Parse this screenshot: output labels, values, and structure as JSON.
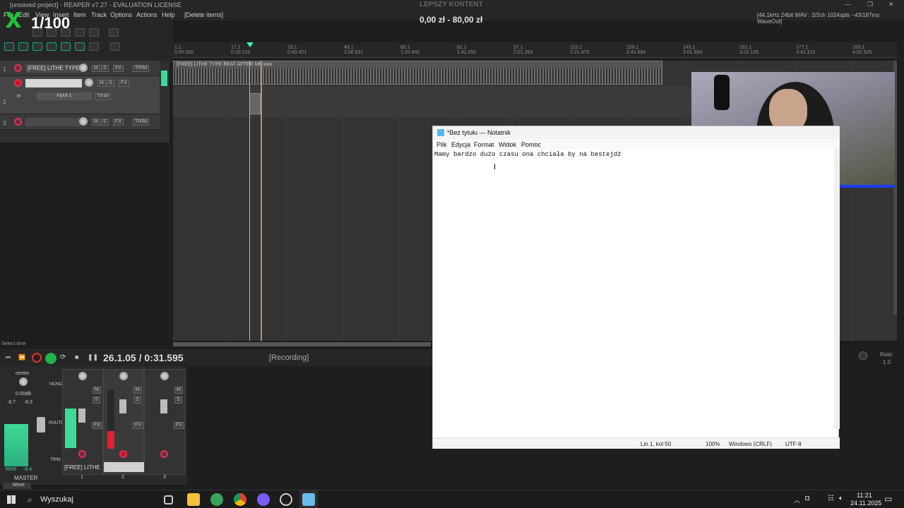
{
  "window": {
    "title": "[unsaved project] - REAPER v7.27 - EVALUATION LICENSE",
    "overlay_text": "LEPSZY KONTENT",
    "donation": "0,00 zł - 80,00 zł",
    "counter": "1/100",
    "audio_info": "[44.1kHz 24bit WAV : 2/2ch 1024spls ~43/187ms WaveOut]"
  },
  "menu": [
    "File",
    "Edit",
    "View",
    "Insert",
    "Item",
    "Track",
    "Options",
    "Actions",
    "Help",
    "[Delete items]"
  ],
  "ruler": [
    {
      "bar": "1.1",
      "time": "0:00.000"
    },
    {
      "bar": "17.1",
      "time": "0:20.210"
    },
    {
      "bar": "33.1",
      "time": "0:40.421"
    },
    {
      "bar": "49.1",
      "time": "1:00.631"
    },
    {
      "bar": "65.1",
      "time": "1:20.842"
    },
    {
      "bar": "81.1",
      "time": "1:41.052"
    },
    {
      "bar": "97.1",
      "time": "2:01.263"
    },
    {
      "bar": "113.1",
      "time": "2:21.473"
    },
    {
      "bar": "129.1",
      "time": "2:41.684"
    },
    {
      "bar": "145.1",
      "time": "3:01.894"
    },
    {
      "bar": "161.1",
      "time": "3:22.105"
    },
    {
      "bar": "177.1",
      "time": "3:42.315"
    },
    {
      "bar": "193.1",
      "time": "4:02.526"
    }
  ],
  "tracks": [
    {
      "num": "1",
      "name": "[FREE] LITHE TYPE"
    },
    {
      "num": "2",
      "name": "",
      "input": "Input 1",
      "in_label": "in"
    },
    {
      "num": "3",
      "name": ""
    }
  ],
  "track_buttons": {
    "m": "M",
    "s": "S",
    "fx": "FX",
    "trim": "TRIM"
  },
  "item": {
    "label": "[FREE] LITHE TYPE BEAT AFTER ME.wav"
  },
  "transport": {
    "position": "26.1.05 / 0:31.595",
    "status": "[Recording]",
    "select_time": "Select time",
    "rate_label": "Rate:",
    "rate_value": "1.0"
  },
  "mixer": {
    "master_label": "MASTER",
    "center": "center",
    "db": "0.00dB",
    "master_levels": [
      "-8.7",
      "-6.3"
    ],
    "rms": "RMS",
    "rms_value": "-8.4",
    "track_name": "[FREE] LITHE",
    "channel_nums": [
      "1",
      "2",
      "3"
    ],
    "tab": "Mixer",
    "labels": {
      "mono": "MONO",
      "route": "ROUTE",
      "trim": "TRIM",
      "fx": "FX",
      "m": "M",
      "s": "S"
    }
  },
  "notepad": {
    "title": "*Bez tytułu — Notatnik",
    "menu": [
      "Plik",
      "Edycja",
      "Format",
      "Widok",
      "Pomoc"
    ],
    "text": "Mamy bardzo dużo czasu ona chciała by na bestejdż",
    "status": {
      "position": "Lin 1, kol 50",
      "zoom": "100%",
      "eol": "Windows (CRLF)",
      "encoding": "UTF-8"
    }
  },
  "taskbar": {
    "search": "Wyszukaj",
    "time": "11:21",
    "date": "24.11.2025"
  },
  "colors": {
    "accent": "#4eb",
    "record": "#d33",
    "webcam_border": "#1a3dff",
    "meter": "#3fd99a"
  }
}
